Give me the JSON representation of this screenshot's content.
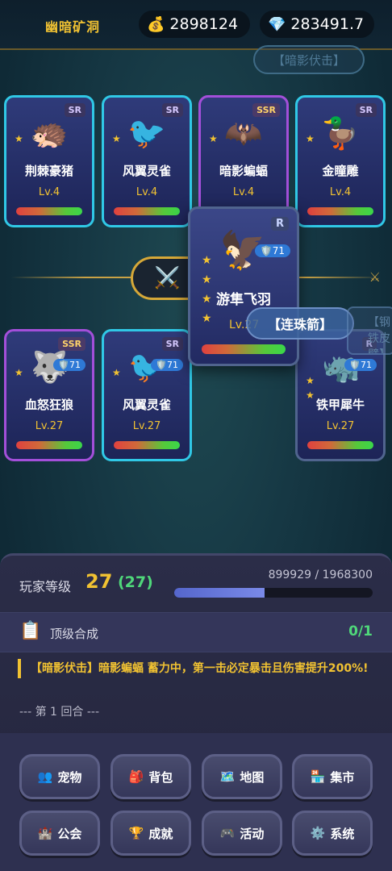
{
  "top": {
    "area": "幽暗矿洞",
    "gold": "2898124",
    "gems": "283491.7"
  },
  "banner": "【暗影伏击】",
  "enemies": [
    {
      "rarity": "SR",
      "emoji": "🦔",
      "star": "★",
      "name": "荆棘豪猪",
      "level": "Lv.4",
      "ssr": false
    },
    {
      "rarity": "SR",
      "emoji": "🐦",
      "star": "★",
      "name": "风翼灵雀",
      "level": "Lv.4",
      "ssr": false
    },
    {
      "rarity": "SSR",
      "emoji": "🦇",
      "star": "★",
      "name": "暗影蝙蝠",
      "level": "Lv.4",
      "ssr": true
    },
    {
      "rarity": "SR",
      "emoji": "🦆",
      "star": "★",
      "name": "金瞳雕",
      "level": "Lv.4",
      "ssr": false
    }
  ],
  "vs_glyph": "⚔️ [",
  "swords_right": "⚔",
  "active_pet": {
    "rarity": "R",
    "emoji": "🦅",
    "stars": "★\n★\n★\n★",
    "shield": "🛡️71",
    "name": "游隼飞羽",
    "level": "Lv.27"
  },
  "skill_popup": "【连珠箭】",
  "skill_edge": "【钢\n铁皮\n壁】",
  "allies": [
    {
      "rarity": "SSR",
      "emoji": "🐺",
      "star": "★",
      "shield": "🛡️71",
      "name": "血怒狂狼",
      "level": "Lv.27",
      "ssr": true
    },
    {
      "rarity": "SR",
      "emoji": "🐦",
      "star": "★",
      "shield": "🛡️71",
      "name": "风翼灵雀",
      "level": "Lv.27",
      "ssr": false
    },
    {
      "rarity": "R",
      "emoji": "🦏",
      "star": "★\n★",
      "shield": "🛡️71",
      "name": "铁甲犀牛",
      "level": "Lv.27",
      "ssr": false
    }
  ],
  "player": {
    "label": "玩家等级",
    "level": "27",
    "level_paren": "(27)",
    "xp_text": "899929 / 1968300",
    "xp_fraction": 0.457
  },
  "task": {
    "icon": "📋",
    "label": "顶级合成",
    "count": "0/1"
  },
  "log": {
    "message": "【暗影伏击】暗影蝙蝠 蓄力中，第一击必定暴击且伤害提升200%!",
    "round": "--- 第 1 回合 ---"
  },
  "menu": [
    {
      "icon": "👥",
      "label": "宠物"
    },
    {
      "icon": "🎒",
      "label": "背包"
    },
    {
      "icon": "🗺️",
      "label": "地图"
    },
    {
      "icon": "🏪",
      "label": "集市"
    },
    {
      "icon": "🏰",
      "label": "公会"
    },
    {
      "icon": "🏆",
      "label": "成就"
    },
    {
      "icon": "🎮",
      "label": "活动"
    },
    {
      "icon": "⚙️",
      "label": "系统"
    }
  ]
}
